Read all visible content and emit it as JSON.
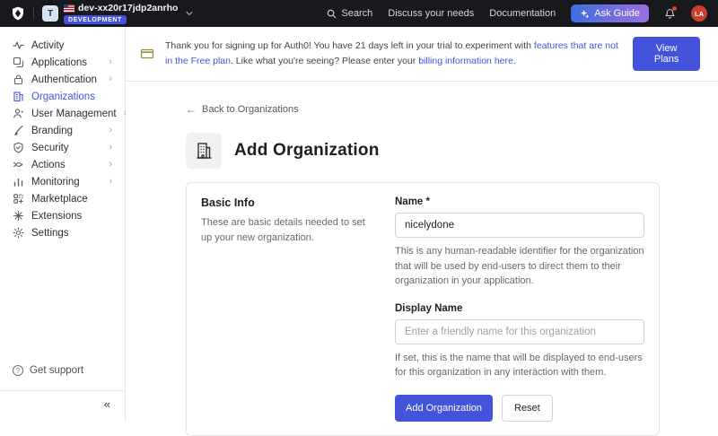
{
  "topbar": {
    "tenant": {
      "initial": "T",
      "name": "dev-xx20r17jdp2anrho",
      "env_badge": "DEVELOPMENT"
    },
    "nav": {
      "search": "Search",
      "discuss": "Discuss your needs",
      "documentation": "Documentation",
      "ask_guide": "Ask Guide"
    },
    "avatar_initials": "LA"
  },
  "banner": {
    "text_1": "Thank you for signing up for Auth0! You have 21 days left in your trial to experiment with ",
    "link_1": "features that are not in the Free plan",
    "text_2": ". Like what you're seeing? Please enter your ",
    "link_2": "billing information here",
    "text_3": ".",
    "cta": "View Plans"
  },
  "sidebar": {
    "items": [
      {
        "label": "Activity"
      },
      {
        "label": "Applications"
      },
      {
        "label": "Authentication"
      },
      {
        "label": "Organizations"
      },
      {
        "label": "User Management"
      },
      {
        "label": "Branding"
      },
      {
        "label": "Security"
      },
      {
        "label": "Actions"
      },
      {
        "label": "Monitoring"
      },
      {
        "label": "Marketplace"
      },
      {
        "label": "Extensions"
      },
      {
        "label": "Settings"
      }
    ],
    "get_support": "Get support",
    "collapse": "«"
  },
  "page": {
    "back_link": "Back to Organizations",
    "title": "Add Organization",
    "card": {
      "section_title": "Basic Info",
      "section_desc": "These are basic details needed to set up your new organization.",
      "name_label": "Name *",
      "name_value": "nicelydone",
      "name_help": "This is any human-readable identifier for the organization that will be used by end-users to direct them to their organization in your application.",
      "display_label": "Display Name",
      "display_placeholder": "Enter a friendly name for this organization",
      "display_help": "If set, this is the name that will be displayed to end-users for this organization in any interaction with them.",
      "submit_label": "Add Organization",
      "reset_label": "Reset"
    }
  },
  "colors": {
    "accent": "#4453dc",
    "topbar_bg": "#17191c",
    "banner_icon": "#9a8b3a",
    "avatar_red": "#c8402f"
  }
}
